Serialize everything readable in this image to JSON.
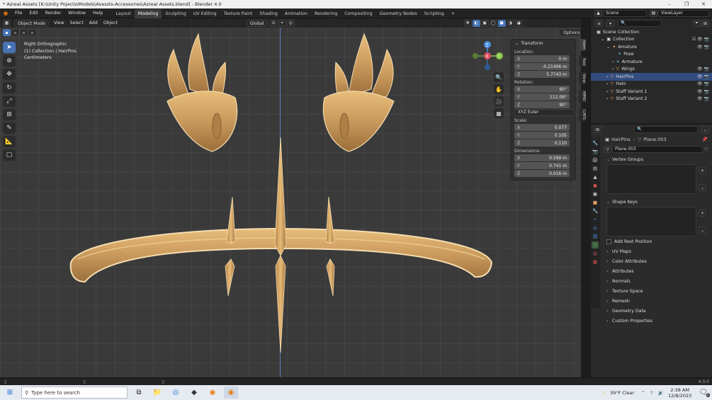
{
  "window": {
    "title": "* Azreal Assets [K:\\Unity Pojects\\Models\\Asessts-Accessories\\Azreal Assets.blend] - Blender 4.0",
    "controls": [
      "–",
      "❐",
      "✕"
    ]
  },
  "menu": [
    "File",
    "Edit",
    "Render",
    "Window",
    "Help"
  ],
  "workspaces": [
    {
      "label": "Layout",
      "active": false
    },
    {
      "label": "Modeling",
      "active": true
    },
    {
      "label": "Sculpting",
      "active": false
    },
    {
      "label": "UV Editing",
      "active": false
    },
    {
      "label": "Texture Paint",
      "active": false
    },
    {
      "label": "Shading",
      "active": false
    },
    {
      "label": "Animation",
      "active": false
    },
    {
      "label": "Rendering",
      "active": false
    },
    {
      "label": "Compositing",
      "active": false
    },
    {
      "label": "Geometry Nodes",
      "active": false
    },
    {
      "label": "Scripting",
      "active": false
    }
  ],
  "add_workspace": "+",
  "scene": {
    "label": "Scene",
    "view_layer": "ViewLayer"
  },
  "viewport_header": {
    "mode": "Object Mode",
    "menus": [
      "View",
      "Select",
      "Add",
      "Object"
    ],
    "transform_orientation": "Global",
    "options": "Options"
  },
  "viewport_info": {
    "view": "Right Orthographic",
    "collection": "(1) Collection | HairPins",
    "units": "Centimeters"
  },
  "npanel": {
    "title": "Transform",
    "location_label": "Location:",
    "location": [
      {
        "axis": "X",
        "value": "0 m"
      },
      {
        "axis": "Y",
        "value": "-0.21406 m"
      },
      {
        "axis": "Z",
        "value": "5.7743 m"
      }
    ],
    "rotation_label": "Rotation:",
    "rotation": [
      {
        "axis": "X",
        "value": "90°"
      },
      {
        "axis": "Y",
        "value": "112.09°"
      },
      {
        "axis": "Z",
        "value": "90°"
      }
    ],
    "rotation_mode": "XYZ Euler",
    "scale_label": "Scale:",
    "scale": [
      {
        "axis": "X",
        "value": "0.077"
      },
      {
        "axis": "Y",
        "value": "0.105"
      },
      {
        "axis": "Z",
        "value": "0.110"
      }
    ],
    "dimensions_label": "Dimensions:",
    "dimensions": [
      {
        "axis": "X",
        "value": "0.599 m"
      },
      {
        "axis": "Y",
        "value": "0.741 m"
      },
      {
        "axis": "Z",
        "value": "0.016 m"
      }
    ]
  },
  "side_tabs": [
    "Item",
    "Tool",
    "View",
    "MMD",
    "CATS"
  ],
  "outliner": {
    "root": "Scene Collection",
    "rows": [
      {
        "label": "Collection",
        "indent": 1
      },
      {
        "label": "Amature",
        "indent": 2
      },
      {
        "label": "Pose",
        "indent": 3
      },
      {
        "label": "Armature",
        "indent": 3
      },
      {
        "label": "Wings",
        "indent": 3
      },
      {
        "label": "HairPins",
        "indent": 2
      },
      {
        "label": "Halo",
        "indent": 2
      },
      {
        "label": "Staff Variant 1",
        "indent": 2
      },
      {
        "label": "Staff Variant 2",
        "indent": 2
      }
    ]
  },
  "properties": {
    "breadcrumb_object": "HairPins",
    "breadcrumb_mesh": "Plane.003",
    "mesh_name": "Plane.003",
    "vertex_groups": "Vertex Groups",
    "shape_keys": "Shape Keys",
    "add_rest_position": "Add Rest Position",
    "sections": [
      "UV Maps",
      "Color Attributes",
      "Attributes",
      "Normals",
      "Texture Space",
      "Remesh",
      "Geometry Data",
      "Custom Properties"
    ]
  },
  "statusbar": {
    "version": "4.0.0"
  },
  "taskbar": {
    "search_placeholder": "Type here to search",
    "weather": "39°F  Clear",
    "time": "2:38 AM",
    "date": "12/8/2023",
    "notification_count": "5"
  },
  "colors": {
    "accent": "#4772b3",
    "gold": "#d4a464",
    "viewport_bg": "#3a3a3a",
    "axis_x": "#e04f5f",
    "axis_y": "#8bc34a",
    "axis_z": "#4a90e2"
  }
}
